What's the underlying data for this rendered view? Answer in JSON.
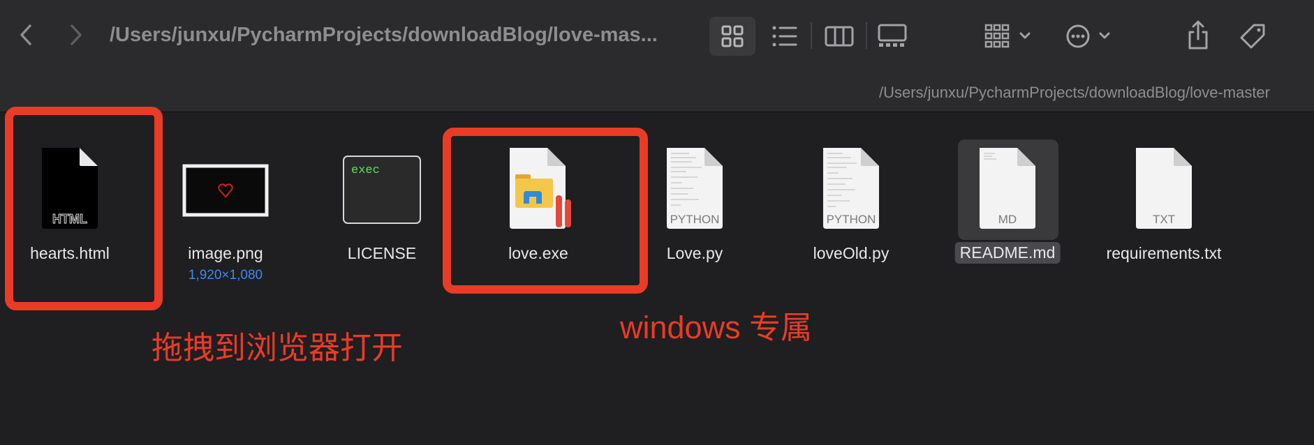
{
  "toolbar": {
    "path_title": "/Users/junxu/PycharmProjects/downloadBlog/love-mas...",
    "back_icon": "chevron-left-icon",
    "forward_icon": "chevron-right-icon",
    "view_icons": [
      "grid-view-icon",
      "list-view-icon",
      "column-view-icon",
      "gallery-view-icon",
      "group-icon",
      "more-actions-icon",
      "share-icon",
      "tag-icon"
    ]
  },
  "path_bar": {
    "path": "/Users/junxu/PycharmProjects/downloadBlog/love-master"
  },
  "files": [
    {
      "name": "hearts.html",
      "badge": "HTML"
    },
    {
      "name": "image.png",
      "sub": "1,920×1,080"
    },
    {
      "name": "LICENSE",
      "badge": "exec"
    },
    {
      "name": "love.exe"
    },
    {
      "name": "Love.py",
      "badge": "PYTHON"
    },
    {
      "name": "loveOld.py",
      "badge": "PYTHON"
    },
    {
      "name": "README.md",
      "badge": "MD"
    },
    {
      "name": "requirements.txt",
      "badge": "TXT"
    }
  ],
  "annotations": {
    "drag_to_browser": "拖拽到浏览器打开",
    "windows_only": "windows 专属"
  },
  "colors": {
    "annotation_red": "#ea3b26",
    "accent_blue": "#3d8bf5"
  }
}
